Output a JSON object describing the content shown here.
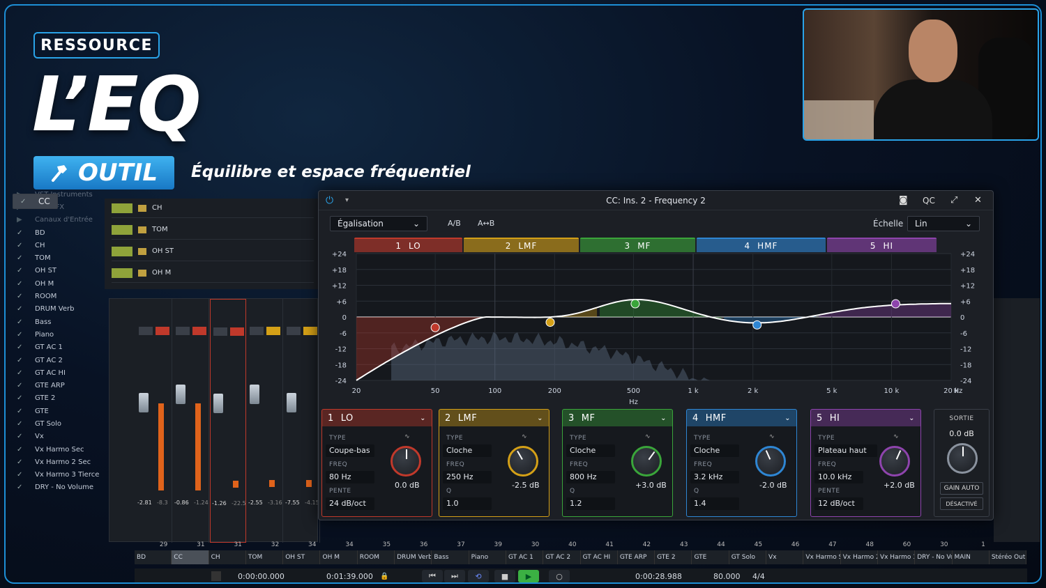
{
  "overlay": {
    "badge": "RESSOURCE",
    "title": "L’EQ",
    "tool_label": "OUTIL",
    "subtitle": "Équilibre et espace fréquentiel"
  },
  "tracks": [
    "VST Instruments",
    "Voies FX",
    "Canaux d'Entrée",
    "BD",
    "CC",
    "CH",
    "TOM",
    "OH ST",
    "OH M",
    "ROOM",
    "DRUM Verb",
    "Bass",
    "Piano",
    "GT AC 1",
    "GT AC 2",
    "GT AC HI",
    "GTE ARP",
    "GTE 2",
    "GTE",
    "GT Solo",
    "Vx",
    "Vx Harmo Sec",
    "Vx Harmo 2 Sec",
    "Vx Harmo 3 Tierce",
    "DRY - No Volume"
  ],
  "selected_track": "CC",
  "arrange_rows": [
    "CH",
    "TOM",
    "OH ST",
    "OH M"
  ],
  "mixer_strips": [
    {
      "name": "CC",
      "value": "-2.81",
      "peak": "-8.3"
    },
    {
      "name": "CH",
      "value": "-0.86",
      "peak": "-1.24"
    },
    {
      "name": "TOM",
      "value": "-1.26",
      "peak": "-22.5"
    },
    {
      "name": "OH ST",
      "value": "-2.55",
      "peak": "-3.16"
    },
    {
      "name": "OH M",
      "value": "-7.55",
      "peak": "-4.15"
    }
  ],
  "channel_numbers": [
    "29",
    "31",
    "31",
    "32",
    "34",
    "34",
    "35",
    "36",
    "37",
    "39",
    "30",
    "40",
    "41",
    "42",
    "43",
    "44",
    "45",
    "46",
    "47",
    "48",
    "60",
    "30",
    "1"
  ],
  "channel_names": [
    "BD",
    "CC",
    "CH",
    "TOM",
    "OH ST",
    "OH M",
    "ROOM",
    "DRUM Verb",
    "Bass",
    "Piano",
    "GT AC 1",
    "GT AC 2",
    "GT AC HI",
    "GTE ARP",
    "GTE 2",
    "GTE",
    "GT Solo",
    "Vx",
    "Vx Harmo Sec",
    "Vx Harmo 2 Sec",
    "Vx Harmo 3 Tierce",
    "DRY - No Volume",
    "MAIN",
    "Stéréo Out"
  ],
  "transport": {
    "left_time": "0:00:00.000",
    "right_time": "0:01:39.000",
    "position": "0:00:28.988",
    "tempo": "80.000",
    "signature": "4/4"
  },
  "eq": {
    "window_title": "CC: Ins. 2 - Frequency 2",
    "qc": "QC",
    "preset": "Égalisation",
    "ab": "A/B",
    "atob": "A↔B",
    "scale_label": "Échelle",
    "scale_value": "Lin",
    "hz_label": "Hz",
    "y_ticks": [
      "+24",
      "+18",
      "+12",
      "+6",
      "0",
      "-6",
      "-12",
      "-18",
      "-24"
    ],
    "x_ticks": [
      "20",
      "50",
      "100",
      "200",
      "500",
      "1 k",
      "2 k",
      "5 k",
      "10 k",
      "20 k",
      "Hz"
    ],
    "bands": [
      {
        "num": "1",
        "name": "LO",
        "color": "#c0392b",
        "type": "Coupe-bas",
        "freq": "80 Hz",
        "third_label": "PENTE",
        "third": "24 dB/oct",
        "gain": "0.0 dB",
        "freq_hz": 50,
        "gain_db": -4
      },
      {
        "num": "2",
        "name": "LMF",
        "color": "#d4a017",
        "type": "Cloche",
        "freq": "250 Hz",
        "third_label": "Q",
        "third": "1.0",
        "gain": "-2.5 dB",
        "freq_hz": 190,
        "gain_db": -2
      },
      {
        "num": "3",
        "name": "MF",
        "color": "#3aa53a",
        "type": "Cloche",
        "freq": "800 Hz",
        "third_label": "Q",
        "third": "1.2",
        "gain": "+3.0 dB",
        "freq_hz": 510,
        "gain_db": 5
      },
      {
        "num": "4",
        "name": "HMF",
        "color": "#2e86d4",
        "type": "Cloche",
        "freq": "3.2 kHz",
        "third_label": "Q",
        "third": "1.4",
        "gain": "-2.0 dB",
        "freq_hz": 2100,
        "gain_db": -3
      },
      {
        "num": "5",
        "name": "HI",
        "color": "#8e44ad",
        "type": "Plateau haut",
        "freq": "10.0 kHz",
        "third_label": "PENTE",
        "third": "12 dB/oct",
        "gain": "+2.0 dB",
        "freq_hz": 10500,
        "gain_db": 5
      }
    ],
    "type_label": "TYPE",
    "freq_label": "FREQ",
    "output": {
      "label": "SORTIE",
      "value": "0.0 dB",
      "gain_auto": "GAIN AUTO",
      "desactive": "DÉSACTIVÉ"
    }
  }
}
